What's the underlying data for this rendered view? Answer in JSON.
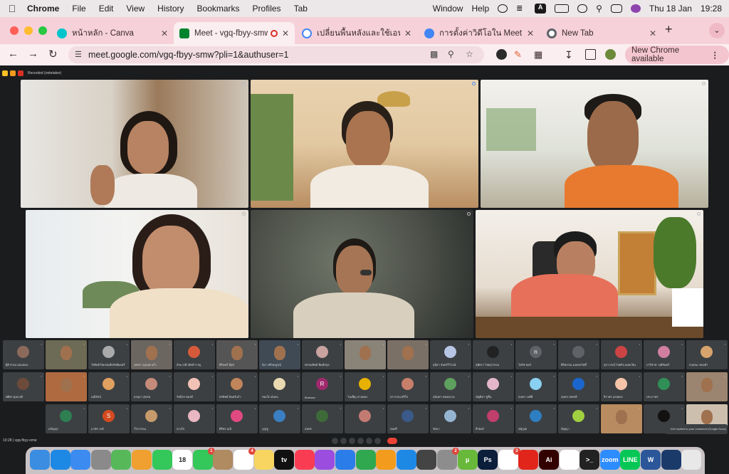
{
  "menubar": {
    "app": "Chrome",
    "items": [
      "File",
      "Edit",
      "View",
      "History",
      "Bookmarks",
      "Profiles",
      "Tab",
      "Window",
      "Help"
    ],
    "date": "Thu 18 Jan",
    "time": "19:28",
    "input_icon": "A"
  },
  "tabs": [
    {
      "title": "หน้าหลัก - Canva",
      "fav_color": "#00c4cc",
      "icon": "canva-icon"
    },
    {
      "title": "Meet - vgq-fbyy-smw",
      "fav_color": "#00832d",
      "icon": "meet-icon"
    },
    {
      "title": "เปลี่ยนพื้นหลังและใช้เอฟเฟกต์",
      "fav_color": "#4285f4",
      "icon": "google-icon"
    },
    {
      "title": "การตั้งค่าวิดีโอใน Meet - คอมพิวเตอร์",
      "fav_color": "#4285f4",
      "icon": "help-icon"
    },
    {
      "title": "New Tab",
      "fav_color": "#5f6368",
      "icon": "chrome-icon"
    }
  ],
  "omnibox": {
    "url": "meet.google.com/vgq-fbyy-smw?pli=1&authuser=1"
  },
  "update_button": "New Chrome available",
  "meet": {
    "recording_label": "Recorded (notetaker)",
    "meeting_code": "19:28 | vgq-fbyy-smw",
    "toast": "Kiet replied to your comment (Google Docs)"
  },
  "small_tiles": [
    {
      "name": "ฐิติวรรณ อ่อนสอน",
      "avatar": "photo",
      "color": "#8c6a5a"
    },
    {
      "name": "",
      "avatar": "video",
      "color": "#6d6a55"
    },
    {
      "name": "ใจทิพย์ ปิยะนันท์ทรัพย์ยอดรี",
      "avatar": "photo",
      "color": "#aaaaaa"
    },
    {
      "name": "เพชรา จุลเลศ แก้ว",
      "avatar": "video",
      "color": "#6b6660"
    },
    {
      "name": "สังฆวรดี เลิศสำราญ",
      "avatar": "photo",
      "color": "#d65a3a"
    },
    {
      "name": "ศิรินทร์ มีสุข",
      "avatar": "video",
      "color": "#555"
    },
    {
      "name": "นิภา ศรีสมบูรณ์",
      "avatar": "video",
      "color": "#3f4a55"
    },
    {
      "name": "พรรณทิพย์ พิมพ์สกุล",
      "avatar": "photo",
      "color": "#c8a3a0"
    },
    {
      "name": "",
      "avatar": "video",
      "color": "#8a8378"
    },
    {
      "name": "",
      "avatar": "video",
      "color": "#7a7066"
    },
    {
      "name": "สุนิสา จันทร์วิโรจน์",
      "avatar": "photo",
      "color": "#b7c6e5"
    },
    {
      "name": "สุพัตรา ไชยสุวรรณ",
      "avatar": "photo",
      "color": "#222"
    },
    {
      "name": "ไพรัช พงษ์",
      "avatar": "letter",
      "letter": "n",
      "color": "#5f6368"
    },
    {
      "name": "ศิริพรรณ มงคลสวัสดิ์",
      "avatar": "photo",
      "color": "#5f6368"
    },
    {
      "name": "สุภาภรณ์ ไชยกิจ ยอดเวียง",
      "avatar": "photo",
      "color": "#c44"
    },
    {
      "name": "ปาริชาต วงศ์จันทร์",
      "avatar": "photo",
      "color": "#d07fa0"
    },
    {
      "name": "กฤษณะ ทองคำ",
      "avatar": "photo",
      "color": "#d7a46d"
    },
    {
      "name": "ศศิธร คุณวงศ์",
      "avatar": "photo",
      "color": "#6d4b3a"
    },
    {
      "name": "",
      "avatar": "video",
      "color": "#b06a40"
    },
    {
      "name": "มณีรัตน์",
      "avatar": "photo",
      "color": "#e0a060"
    },
    {
      "name": "อรอุมา สุขสม",
      "avatar": "photo",
      "color": "#c58b7a"
    },
    {
      "name": "รัชนีกร ทองดี",
      "avatar": "photo",
      "color": "#f2c1b5"
    },
    {
      "name": "พรทิพย์ อินทร์แก้ว",
      "avatar": "photo",
      "color": "#c0855a"
    },
    {
      "name": "ทองใบ มั่นคง",
      "avatar": "photo",
      "color": "#e9d9b0"
    },
    {
      "name": "Bumsan",
      "avatar": "letter",
      "letter": "R",
      "color": "#a1296d"
    },
    {
      "name": "วันเพ็ญ ปานทอง",
      "avatar": "photo",
      "color": "#e7b100"
    },
    {
      "name": "อรวรรณ ศรีใส",
      "avatar": "photo",
      "color": "#c87f6a"
    },
    {
      "name": "สุนันทา พลอยงาม",
      "avatar": "photo",
      "color": "#5ea05e"
    },
    {
      "name": "ณัฐธิดา ชูชื่น",
      "avatar": "photo",
      "color": "#e4b6c9"
    },
    {
      "name": "ธนพร วงศ์ดี",
      "avatar": "photo",
      "color": "#8ad0f0"
    },
    {
      "name": "สุนทร เพชรดี",
      "avatar": "photo",
      "color": "#1a66cc"
    },
    {
      "name": "จิราพร แสงทอง",
      "avatar": "photo",
      "color": "#f6c4a8"
    },
    {
      "name": "ประภาพร",
      "avatar": "photo",
      "color": "#2f8f56"
    },
    {
      "name": "",
      "avatar": "video",
      "color": "#9b8570"
    },
    {
      "name": "อภิญญา",
      "avatar": "photo",
      "color": "#2f7f52"
    },
    {
      "name": "มาลัย วงค์",
      "avatar": "letter",
      "letter": "S",
      "color": "#d44a1f"
    },
    {
      "name": "วิไลวรรณ",
      "avatar": "photo",
      "color": "#c69b6b"
    },
    {
      "name": "ดวงใจ",
      "avatar": "photo",
      "color": "#e9b7c1"
    },
    {
      "name": "ศิริพร มณี",
      "avatar": "photo",
      "color": "#e04a80"
    },
    {
      "name": "บุญชู",
      "avatar": "photo",
      "color": "#3a7fc2"
    },
    {
      "name": "สมพร",
      "avatar": "photo",
      "color": "#3e6a3a"
    },
    {
      "name": "",
      "avatar": "photo",
      "color": "#c27b73"
    },
    {
      "name": "สมศรี",
      "avatar": "photo",
      "color": "#3a5a8c"
    },
    {
      "name": "รัตนา",
      "avatar": "photo",
      "color": "#95b4d2"
    },
    {
      "name": "ธีรพงษ์",
      "avatar": "photo",
      "color": "#c13f6b"
    },
    {
      "name": "ณัฐวุฒิ",
      "avatar": "photo",
      "color": "#2e7fc1"
    },
    {
      "name": "ปัญญา",
      "avatar": "photo",
      "color": "#a0d040"
    },
    {
      "name": "",
      "avatar": "video",
      "color": "#b88b60"
    },
    {
      "name": "",
      "avatar": "photo",
      "color": "#111"
    },
    {
      "name": "",
      "avatar": "video",
      "color": "#cdbfae"
    }
  ],
  "dock": [
    {
      "name": "Finder",
      "color": "#3a8de0",
      "glyph": ""
    },
    {
      "name": "Safari",
      "color": "#1e88e5",
      "glyph": ""
    },
    {
      "name": "Mail",
      "color": "#3b8bf0",
      "glyph": ""
    },
    {
      "name": "Launchpad",
      "color": "#8a8a8a",
      "glyph": ""
    },
    {
      "name": "Maps",
      "color": "#57b85a",
      "glyph": ""
    },
    {
      "name": "Photos",
      "color": "#f0a030",
      "glyph": ""
    },
    {
      "name": "FaceTime",
      "color": "#34c759",
      "glyph": ""
    },
    {
      "name": "Calendar",
      "color": "#ffffff",
      "glyph": "18"
    },
    {
      "name": "Messages",
      "color": "#34c759",
      "glyph": "",
      "badge": "1"
    },
    {
      "name": "Contacts",
      "color": "#b08a60",
      "glyph": ""
    },
    {
      "name": "Reminders",
      "color": "#ffffff",
      "glyph": "",
      "badge": "4"
    },
    {
      "name": "Notes",
      "color": "#f7d560",
      "glyph": ""
    },
    {
      "name": "TV",
      "color": "#111111",
      "glyph": "tv"
    },
    {
      "name": "Music",
      "color": "#fa3c52",
      "glyph": ""
    },
    {
      "name": "Podcasts",
      "color": "#9b4de0",
      "glyph": ""
    },
    {
      "name": "Keynote",
      "color": "#2b7de9",
      "glyph": ""
    },
    {
      "name": "Numbers",
      "color": "#2fa84f",
      "glyph": ""
    },
    {
      "name": "Pages",
      "color": "#f29b1c",
      "glyph": ""
    },
    {
      "name": "App Store",
      "color": "#1e88e5",
      "glyph": ""
    },
    {
      "name": "QuickTime",
      "color": "#444444",
      "glyph": ""
    },
    {
      "name": "System Settings",
      "color": "#8d8d8d",
      "glyph": "",
      "badge": "2"
    },
    {
      "name": "uTorrent",
      "color": "#68b83a",
      "glyph": "µ"
    },
    {
      "name": "Photoshop",
      "color": "#0b1e3a",
      "glyph": "Ps"
    },
    {
      "name": "Slack",
      "color": "#ffffff",
      "glyph": "",
      "badge": "3"
    },
    {
      "name": "Acrobat",
      "color": "#e1251b",
      "glyph": ""
    },
    {
      "name": "Illustrator",
      "color": "#330000",
      "glyph": "Ai"
    },
    {
      "name": "Chrome",
      "color": "#ffffff",
      "glyph": ""
    },
    {
      "name": "Terminal",
      "color": "#222222",
      "glyph": ">_"
    },
    {
      "name": "Zoom",
      "color": "#2d8cff",
      "glyph": "zoom"
    },
    {
      "name": "LINE",
      "color": "#06c755",
      "glyph": "LINE"
    },
    {
      "name": "Word",
      "color": "#2b579a",
      "glyph": "W"
    },
    {
      "name": "Screen",
      "color": "#1a3a6a",
      "glyph": ""
    },
    {
      "name": "Trash",
      "color": "#e8e8e8",
      "glyph": ""
    }
  ]
}
